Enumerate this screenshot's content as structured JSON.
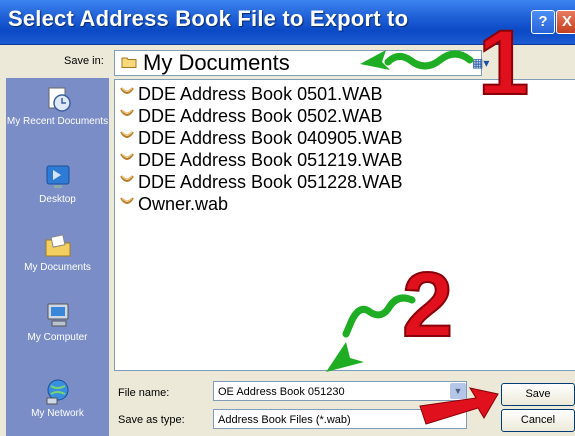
{
  "window": {
    "title": "Select Address Book File to Export to",
    "help_label": "?",
    "close_label": "X"
  },
  "save_in": {
    "label": "Save in:",
    "value": "My Documents"
  },
  "places": [
    {
      "label": "My Recent Documents"
    },
    {
      "label": "Desktop"
    },
    {
      "label": "My Documents"
    },
    {
      "label": "My Computer"
    },
    {
      "label": "My Network"
    }
  ],
  "files": [
    {
      "name": "DDE Address Book 0501.WAB"
    },
    {
      "name": "DDE Address Book 0502.WAB"
    },
    {
      "name": "DDE Address Book 040905.WAB"
    },
    {
      "name": "DDE Address Book 051219.WAB"
    },
    {
      "name": "DDE Address Book 051228.WAB"
    },
    {
      "name": "Owner.wab"
    }
  ],
  "file_name": {
    "label": "File name:",
    "value": "OE Address Book 051230"
  },
  "save_as_type": {
    "label": "Save as type:",
    "value": "Address Book Files (*.wab)"
  },
  "buttons": {
    "save": "Save",
    "cancel": "Cancel"
  },
  "annotations": {
    "step1": "1",
    "step2": "2"
  },
  "colors": {
    "title_bar": "#0b49c5",
    "places_bar": "#7a8dc7",
    "annotation_red": "#e0101c",
    "annotation_green": "#1fae23"
  }
}
